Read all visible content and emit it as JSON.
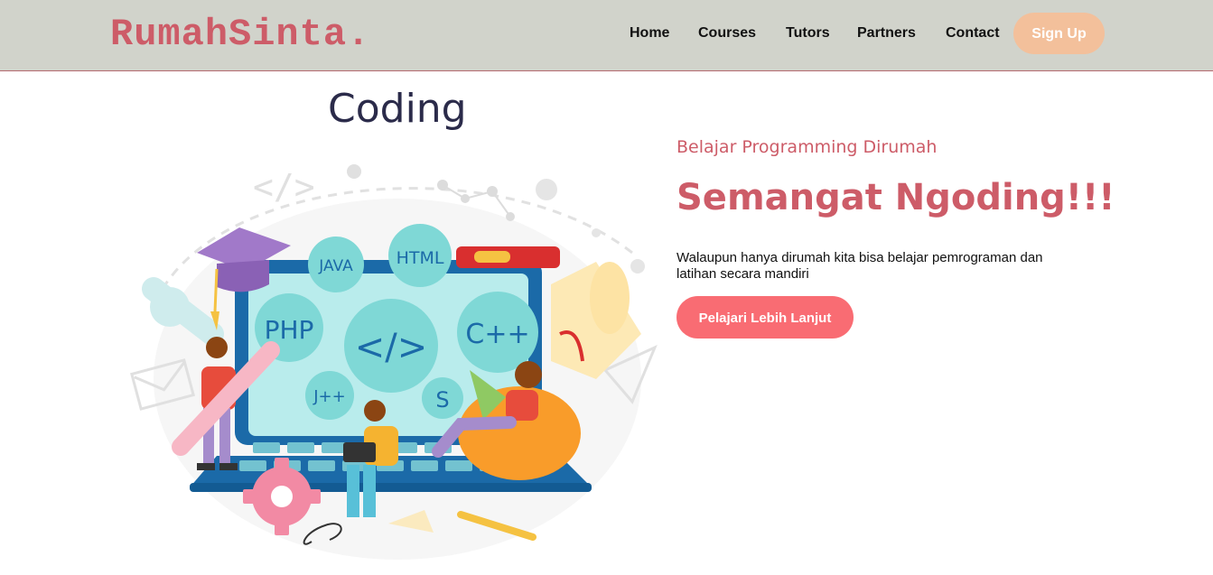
{
  "navbar": {
    "logo": "RumahSinta.",
    "links": [
      "Home",
      "Courses",
      "Tutors",
      "Partners",
      "Contact"
    ],
    "signup": "Sign Up"
  },
  "hero": {
    "title": "Coding",
    "subheading": "Belajar Programming Dirumah",
    "heading": "Semangat Ngoding!!!",
    "description": "Walaupun hanya dirumah kita bisa belajar pemrograman dan latihan secara mandiri",
    "cta": "Pelajari Lebih Lanjut"
  },
  "illustration": {
    "code_tag": "</>",
    "badges": [
      "JAVA",
      "HTML",
      "PHP",
      "C++",
      "J++",
      "S"
    ]
  },
  "colors": {
    "navbar_bg": "#d1d3cb",
    "brand": "#cd5c68",
    "signup": "#f3c09b",
    "cta": "#f96c73",
    "bubble": "#7fd8d6",
    "laptop": "#1b6aa8"
  }
}
